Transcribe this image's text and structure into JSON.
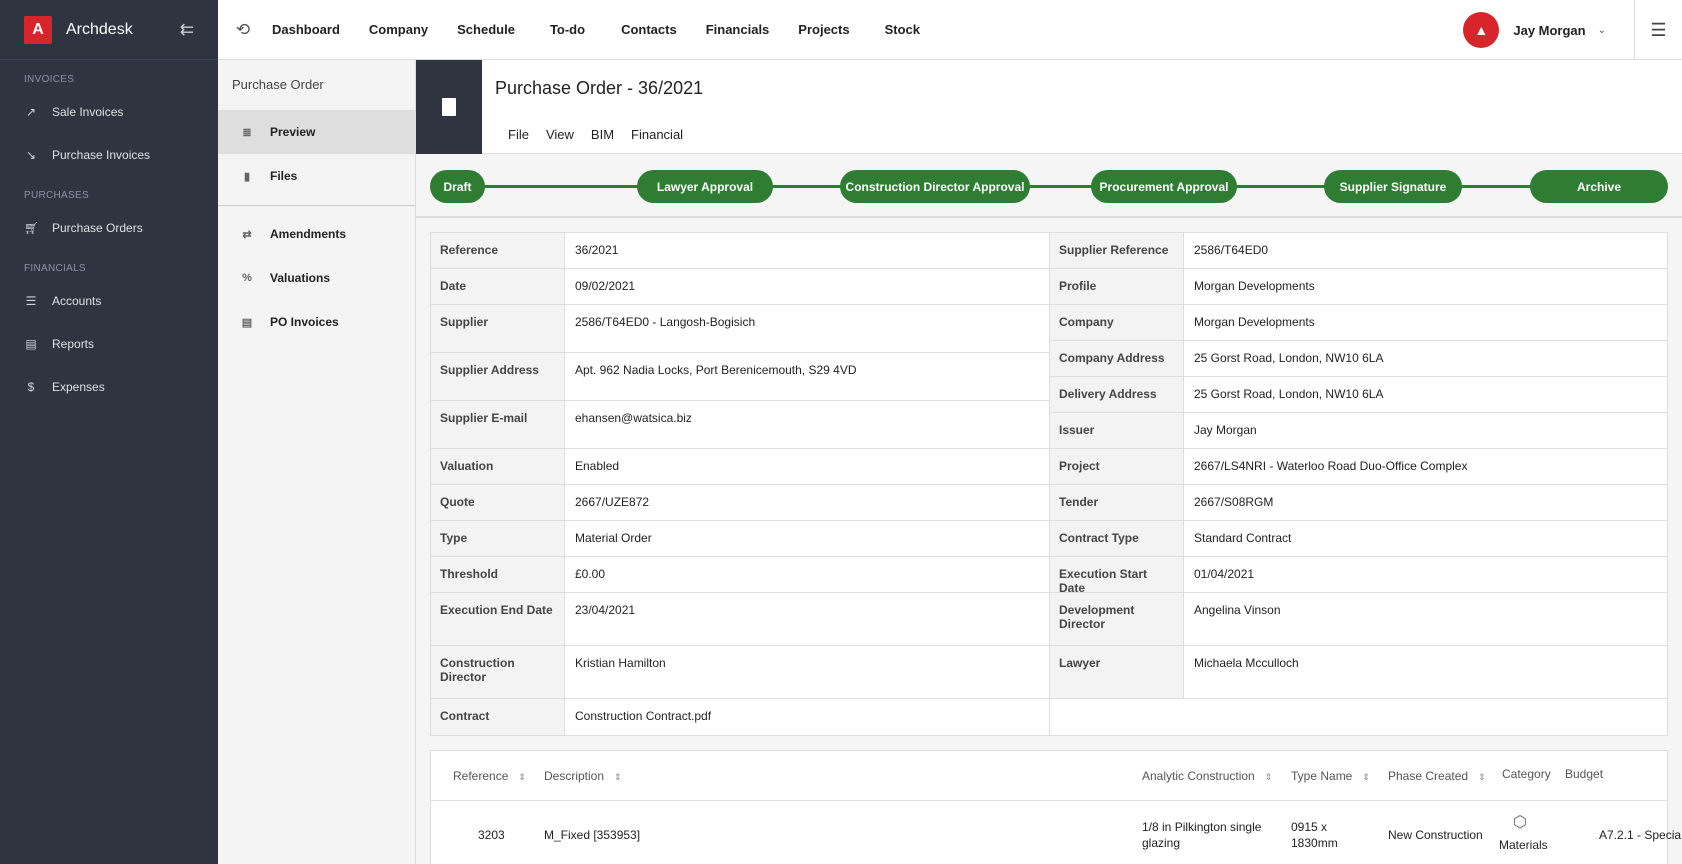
{
  "app": {
    "brand": "Archdesk",
    "logo_letter": "A"
  },
  "sidebar": {
    "sections": [
      {
        "title": "INVOICES",
        "items": [
          {
            "label": "Sale Invoices",
            "icon": "trending-up-icon"
          },
          {
            "label": "Purchase Invoices",
            "icon": "trending-down-icon"
          }
        ]
      },
      {
        "title": "PURCHASES",
        "items": [
          {
            "label": "Purchase Orders",
            "icon": "cart-icon"
          }
        ]
      },
      {
        "title": "FINANCIALS",
        "items": [
          {
            "label": "Accounts",
            "icon": "list-icon"
          },
          {
            "label": "Reports",
            "icon": "report-icon"
          },
          {
            "label": "Expenses",
            "icon": "dollar-icon"
          }
        ]
      }
    ]
  },
  "topnav": {
    "items": [
      "Dashboard",
      "Company",
      "Schedule",
      "To-do",
      "Contacts",
      "Financials",
      "Projects",
      "Stock"
    ]
  },
  "user": {
    "name": "Jay Morgan"
  },
  "subnav": {
    "title": "Purchase Order",
    "items": [
      {
        "label": "Preview",
        "icon": "lines-icon"
      },
      {
        "label": "Files",
        "icon": "file-icon"
      },
      {
        "label": "Amendments",
        "icon": "swap-icon"
      },
      {
        "label": "Valuations",
        "icon": "percent-icon"
      },
      {
        "label": "PO Invoices",
        "icon": "invoice-icon"
      }
    ]
  },
  "document": {
    "title": "Purchase Order - 36/2021",
    "menu": [
      "File",
      "View",
      "BIM",
      "Financial"
    ]
  },
  "workflow": {
    "steps": [
      "Draft",
      "Lawyer Approval",
      "Construction Director Approval",
      "Procurement Approval",
      "Supplier Signature",
      "Archive"
    ]
  },
  "details": {
    "left": [
      {
        "label": "Reference",
        "value": "36/2021"
      },
      {
        "label": "Date",
        "value": "09/02/2021"
      },
      {
        "label": "Supplier",
        "value": "2586/T64ED0 - Langosh-Bogisich"
      },
      {
        "label": "Supplier Address",
        "value": "Apt. 962 Nadia Locks, Port Berenicemouth, S29 4VD"
      },
      {
        "label": "Supplier E-mail",
        "value": "ehansen@watsica.biz"
      },
      {
        "label": "Valuation",
        "value": "Enabled"
      },
      {
        "label": "Quote",
        "value": "2667/UZE872"
      },
      {
        "label": "Type",
        "value": "Material Order"
      },
      {
        "label": "Threshold",
        "value": "£0.00"
      },
      {
        "label": "Execution End Date",
        "value": "23/04/2021"
      },
      {
        "label": "Construction Director",
        "value": "Kristian Hamilton"
      },
      {
        "label": "Contract",
        "value": "Construction Contract.pdf"
      }
    ],
    "right": [
      {
        "label": "Supplier Reference",
        "value": "2586/T64ED0"
      },
      {
        "label": "Profile",
        "value": "Morgan Developments"
      },
      {
        "label": "Company",
        "value": "Morgan Developments"
      },
      {
        "label": "Company Address",
        "value": "25 Gorst Road, London, NW10 6LA"
      },
      {
        "label": "Delivery Address",
        "value": "25 Gorst Road, London, NW10 6LA"
      },
      {
        "label": "Issuer",
        "value": "Jay Morgan"
      },
      {
        "label": "Project",
        "value": "2667/LS4NRI - Waterloo Road Duo-Office Complex"
      },
      {
        "label": "Tender",
        "value": "2667/S08RGM"
      },
      {
        "label": "Contract Type",
        "value": "Standard Contract"
      },
      {
        "label": "Execution Start Date",
        "value": "01/04/2021"
      },
      {
        "label": "Development Director",
        "value": "Angelina Vinson"
      },
      {
        "label": "Lawyer",
        "value": "Michaela Mcculloch"
      }
    ]
  },
  "lines": {
    "headers": [
      "Reference",
      "Description",
      "Analytic Construction",
      "Type Name",
      "Phase Created",
      "Category",
      "Budget"
    ],
    "row": {
      "reference": "3203",
      "description": "M_Fixed [353953]",
      "analytic": "1/8 in Pilkington single glazing",
      "type_name": "0915 x 1830mm",
      "phase": "New Construction",
      "category": "Materials",
      "budget": "A7.2.1 - Specia"
    }
  }
}
